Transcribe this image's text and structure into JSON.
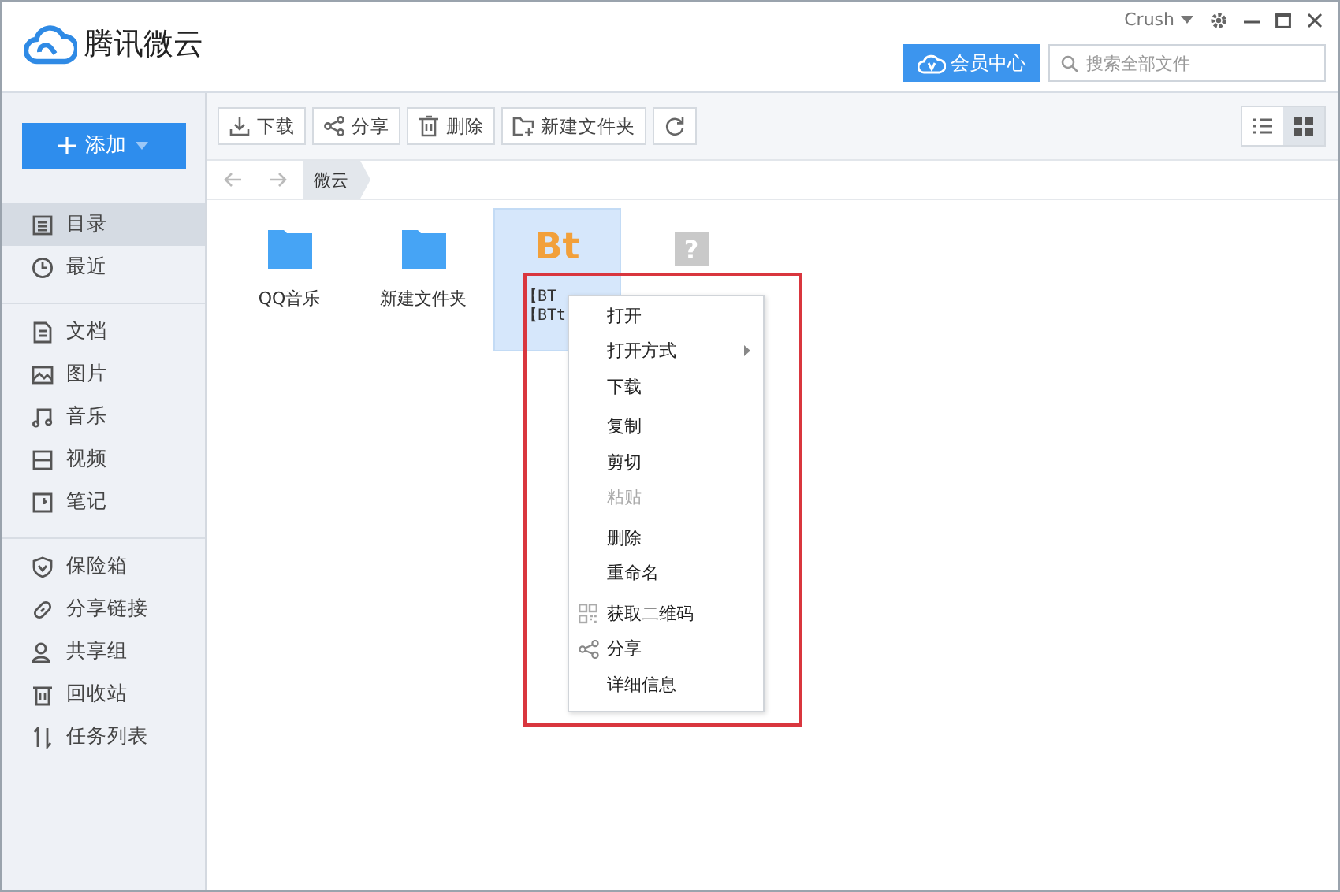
{
  "window": {
    "app_name": "腾讯微云",
    "user": "Crush"
  },
  "header": {
    "vip_button": "会员中心",
    "search": {
      "placeholder": "搜索全部文件"
    }
  },
  "sidebar": {
    "add_button": "添加",
    "sections": [
      [
        {
          "label": "目录",
          "kind": "list",
          "selected": true
        },
        {
          "label": "最近",
          "kind": "clock",
          "selected": false
        }
      ],
      [
        {
          "label": "文档",
          "kind": "doc",
          "selected": false
        },
        {
          "label": "图片",
          "kind": "image",
          "selected": false
        },
        {
          "label": "音乐",
          "kind": "music",
          "selected": false
        },
        {
          "label": "视频",
          "kind": "video",
          "selected": false
        },
        {
          "label": "笔记",
          "kind": "note",
          "selected": false
        }
      ],
      [
        {
          "label": "保险箱",
          "kind": "shield",
          "selected": false
        },
        {
          "label": "分享链接",
          "kind": "link",
          "selected": false
        },
        {
          "label": "共享组",
          "kind": "people",
          "selected": false
        },
        {
          "label": "回收站",
          "kind": "trash",
          "selected": false
        },
        {
          "label": "任务列表",
          "kind": "transfer",
          "selected": false
        }
      ]
    ]
  },
  "toolbar": {
    "buttons": [
      {
        "label": "下载",
        "kind": "download"
      },
      {
        "label": "分享",
        "kind": "share"
      },
      {
        "label": "删除",
        "kind": "trash"
      },
      {
        "label": "新建文件夹",
        "kind": "folder-plus"
      },
      {
        "kind": "refresh"
      }
    ],
    "views": [
      {
        "kind": "list",
        "selected": false
      },
      {
        "kind": "grid",
        "selected": true
      }
    ]
  },
  "breadcrumb": [
    "微云"
  ],
  "files": [
    {
      "kind": "folder",
      "name_lines": [
        "QQ音乐"
      ],
      "selected": false
    },
    {
      "kind": "folder",
      "name_lines": [
        "新建文件夹"
      ],
      "selected": false
    },
    {
      "kind": "bt",
      "badge": "Bt",
      "name_lines": [
        "【BT",
        "【BTt"
      ],
      "selected": true
    },
    {
      "kind": "unknown",
      "badge": "?",
      "selected": false
    }
  ],
  "context_menu": {
    "groups": [
      [
        {
          "label": "打开",
          "kind": "plain",
          "submenu": false,
          "disabled": false
        },
        {
          "label": "打开方式",
          "kind": "plain",
          "submenu": true,
          "disabled": false
        },
        {
          "label": "下载",
          "kind": "plain",
          "submenu": false,
          "disabled": false
        }
      ],
      [
        {
          "label": "复制",
          "kind": "plain",
          "submenu": false,
          "disabled": false
        },
        {
          "label": "剪切",
          "kind": "plain",
          "submenu": false,
          "disabled": false
        },
        {
          "label": "粘贴",
          "kind": "plain",
          "submenu": false,
          "disabled": true
        }
      ],
      [
        {
          "label": "删除",
          "kind": "plain",
          "submenu": false,
          "disabled": false
        },
        {
          "label": "重命名",
          "kind": "plain",
          "submenu": false,
          "disabled": false
        }
      ],
      [
        {
          "label": "获取二维码",
          "kind": "qr",
          "submenu": false,
          "disabled": false
        },
        {
          "label": "分享",
          "kind": "share",
          "submenu": false,
          "disabled": false
        },
        {
          "label": "详细信息",
          "kind": "plain",
          "submenu": false,
          "disabled": false
        }
      ]
    ]
  }
}
